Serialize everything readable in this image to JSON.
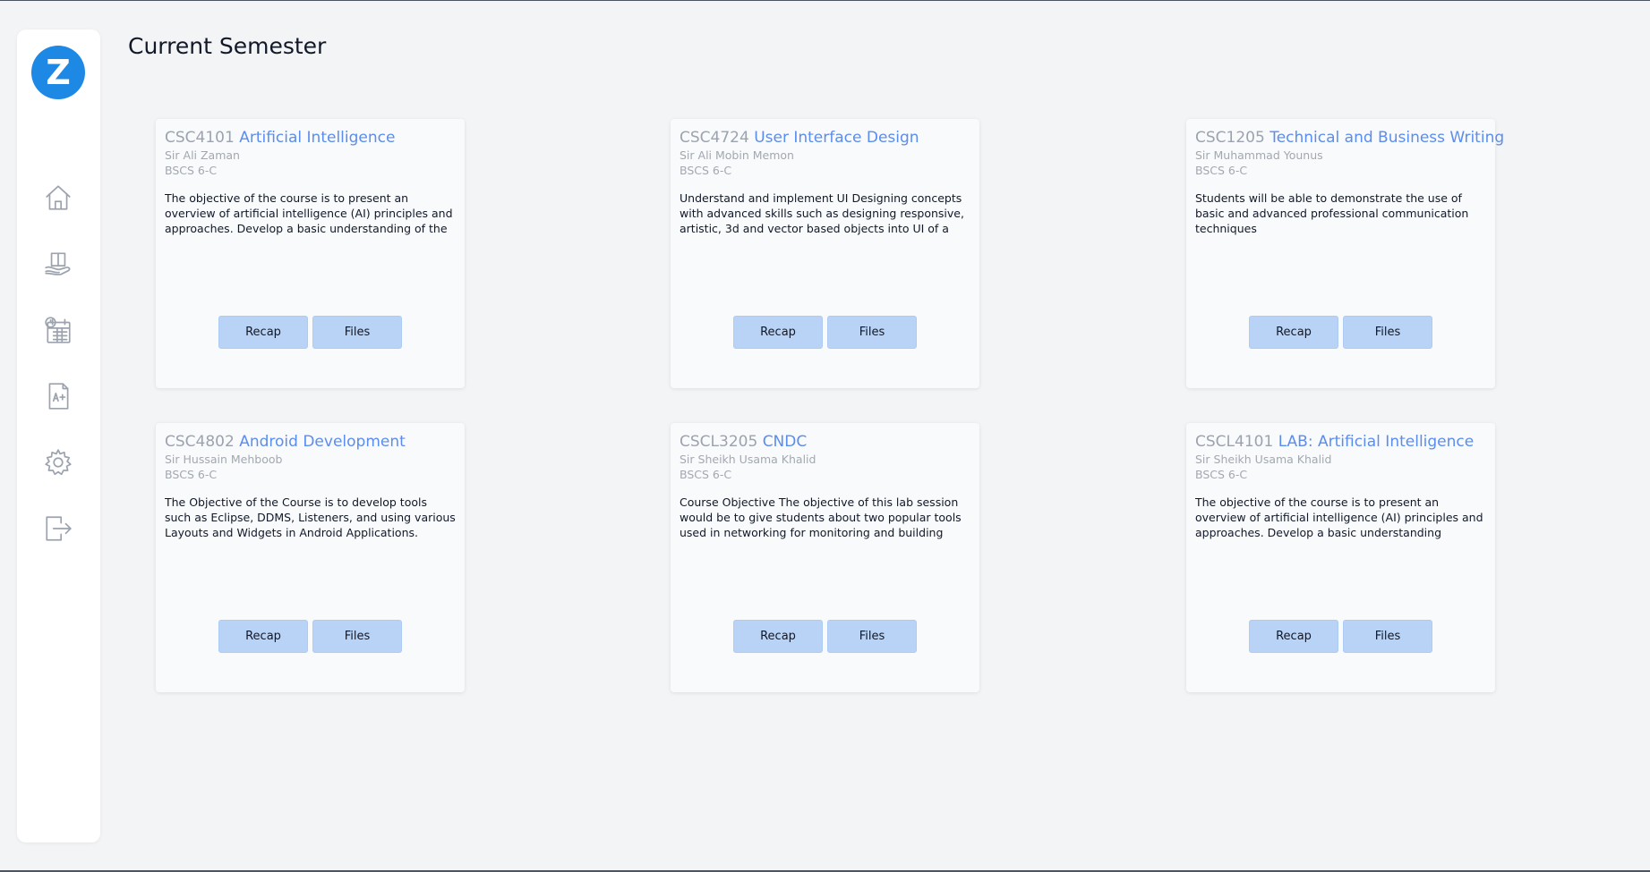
{
  "app": {
    "logo_letter": "Z",
    "accent": "#1e88e5"
  },
  "page": {
    "title": "Current Semester"
  },
  "sidebar": {
    "items": [
      {
        "icon": "home-icon"
      },
      {
        "icon": "book-hand-icon"
      },
      {
        "icon": "calendar-clock-icon"
      },
      {
        "icon": "grade-document-icon"
      },
      {
        "icon": "gear-icon"
      },
      {
        "icon": "logout-icon"
      }
    ]
  },
  "courses": [
    {
      "code": "CSC4101",
      "name": "Artificial Intelligence",
      "teacher": "Sir Ali Zaman",
      "section": "BSCS 6-C",
      "description": "The objective of the course is to present an overview of artificial intelligence (AI) principles and approaches. Develop a basic understanding of the building blocks",
      "recap_label": "Recap",
      "files_label": "Files"
    },
    {
      "code": "CSC4724",
      "name": "User Interface Design",
      "teacher": "Sir Ali Mobin Memon",
      "section": "BSCS 6-C",
      "description": "Understand and implement UI Designing concepts with advanced skills such as designing responsive, artistic, 3d and vector based objects into UI of a web application.",
      "recap_label": "Recap",
      "files_label": "Files"
    },
    {
      "code": "CSC1205",
      "name": "Technical and Business Writing",
      "teacher": "Sir Muhammad Younus",
      "section": "BSCS 6-C",
      "description": "Students will be able to demonstrate the use of basic and advanced professional communication techniques",
      "recap_label": "Recap",
      "files_label": "Files"
    },
    {
      "code": "CSC4802",
      "name": "Android Development",
      "teacher": "Sir Hussain Mehboob",
      "section": "BSCS 6-C",
      "description": "The Objective of the Course is to develop tools such as Eclipse, DDMS, Listeners, and using various Layouts and Widgets in Android Applications.",
      "recap_label": "Recap",
      "files_label": "Files"
    },
    {
      "code": "CSCL3205",
      "name": "CNDC",
      "teacher": "Sir Sheikh Usama Khalid",
      "section": "BSCS 6-C",
      "description": "Course Objective The objective of this lab session would be to give students about two popular tools used in networking for monitoring and building different",
      "recap_label": "Recap",
      "files_label": "Files"
    },
    {
      "code": "CSCL4101",
      "name": "LAB: Artificial Intelligence",
      "teacher": "Sir Sheikh Usama Khalid",
      "section": "BSCS 6-C",
      "description": "The objective of the course is to present an overview of artificial intelligence (AI) principles and approaches. Develop a basic understanding",
      "recap_label": "Recap",
      "files_label": "Files"
    }
  ]
}
